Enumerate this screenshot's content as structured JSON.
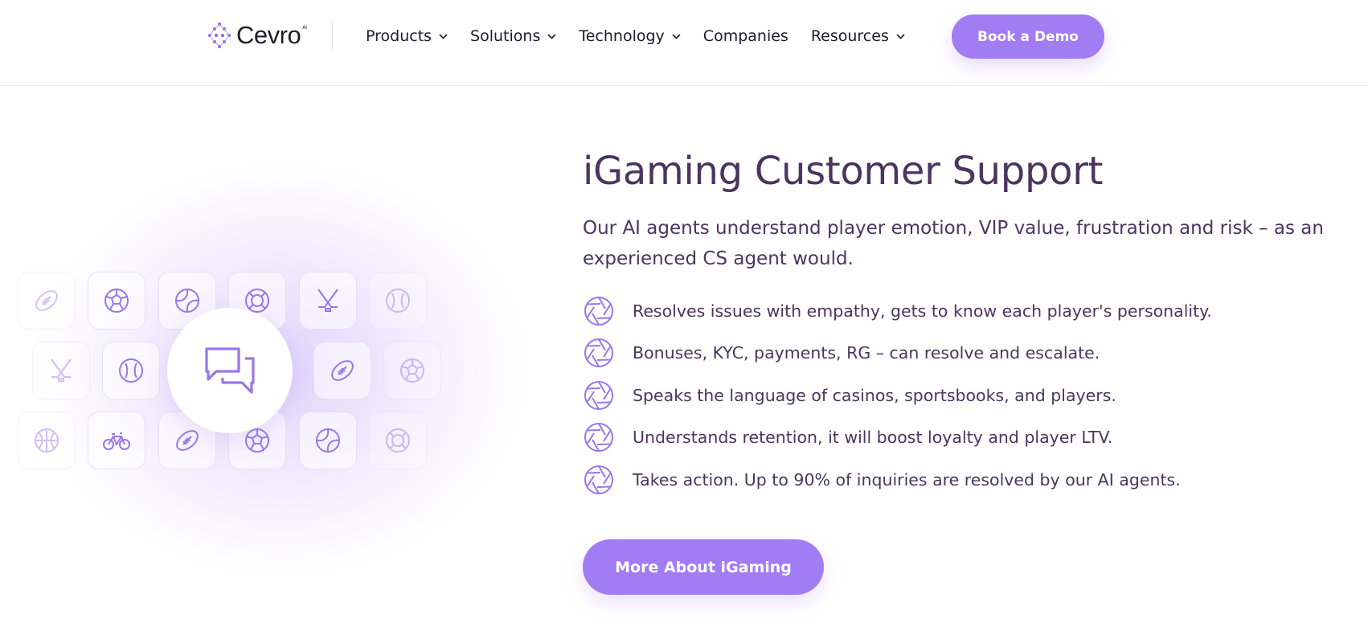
{
  "header": {
    "logo_text": "Cevro",
    "logo_superscript": "AI",
    "nav": [
      {
        "label": "Products",
        "has_dropdown": true
      },
      {
        "label": "Solutions",
        "has_dropdown": true
      },
      {
        "label": "Technology",
        "has_dropdown": true
      },
      {
        "label": "Companies",
        "has_dropdown": false
      },
      {
        "label": "Resources",
        "has_dropdown": true
      }
    ],
    "cta_label": "Book a Demo"
  },
  "illustration": {
    "center_icon": "chat-bubbles-icon",
    "tiles": [
      "american-football-icon",
      "soccer-ball-icon",
      "tennis-ball-icon",
      "life-ring-icon",
      "hockey-sticks-icon",
      "baseball-icon",
      "hockey-sticks-icon",
      "baseball-icon",
      "american-football-icon",
      "soccer-ball-icon",
      "basketball-icon",
      "bicycle-icon",
      "american-football-icon",
      "soccer-ball-icon",
      "tennis-ball-icon",
      "life-ring-icon"
    ]
  },
  "section": {
    "title": "iGaming Customer Support",
    "lead": "Our AI agents understand player emotion, VIP value, frustration and risk – as an experienced CS agent would.",
    "features": [
      "Resolves issues with empathy, gets to know each player's personality.",
      "Bonuses, KYC, payments, RG – can resolve and escalate.",
      "Speaks the language of casinos, sportsbooks, and players.",
      "Understands retention, it will boost loyalty and player LTV.",
      "Takes action. Up to 90% of inquiries are resolved by our AI agents."
    ],
    "feature_icon": "aperture-icon",
    "cta_label": "More About iGaming"
  },
  "colors": {
    "accent": "#a27cf2",
    "heading": "#4b355f",
    "nav_text": "#1f1a2b",
    "icon_stroke": "#9a76e8"
  }
}
